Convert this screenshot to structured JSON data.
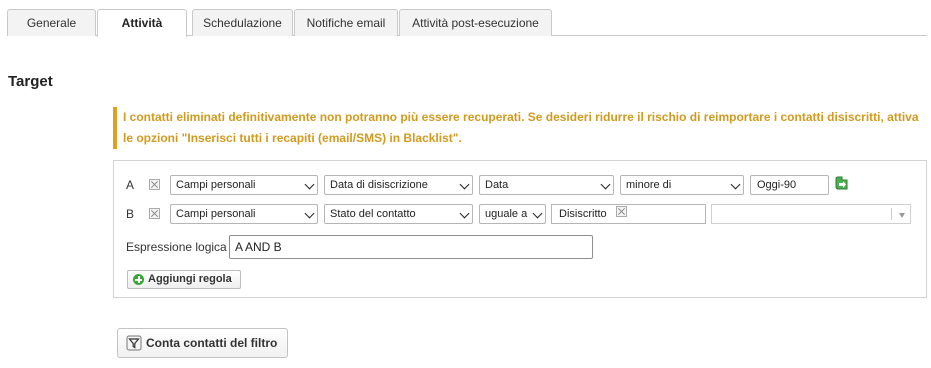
{
  "tabs": [
    {
      "label": "Generale",
      "active": false
    },
    {
      "label": "Attività",
      "active": true
    },
    {
      "label": "Schedulazione",
      "active": false
    },
    {
      "label": "Notifiche email",
      "active": false
    },
    {
      "label": "Attività post-esecuzione",
      "active": false
    }
  ],
  "section": {
    "title": "Target"
  },
  "warning": {
    "text": "I contatti eliminati definitivamente non potranno più essere recuperati. Se desideri ridurre il rischio di reimportare i contatti disiscritti, attiva le opzioni \"Inserisci tutti i recapiti (email/SMS) in Blacklist\".",
    "color": "#d29a1e"
  },
  "rules": [
    {
      "letter": "A",
      "field_group": "Campi personali",
      "field": "Data di disiscrizione",
      "type": "Data",
      "operator": "minore di",
      "value": "Oggi-90",
      "value_icon": "green-arrow-icon"
    },
    {
      "letter": "B",
      "field_group": "Campi personali",
      "field": "Stato del contatto",
      "operator": "uguale a",
      "value_tag": "Disiscritto",
      "extra_select": ""
    }
  ],
  "logic": {
    "label": "Espressione logica",
    "value": "A AND B"
  },
  "buttons": {
    "add_rule": "Aggiungi regola",
    "count_contacts": "Conta contatti del filtro"
  },
  "colors": {
    "warning": "#d29a1e",
    "accent_green": "#3aa63a"
  }
}
